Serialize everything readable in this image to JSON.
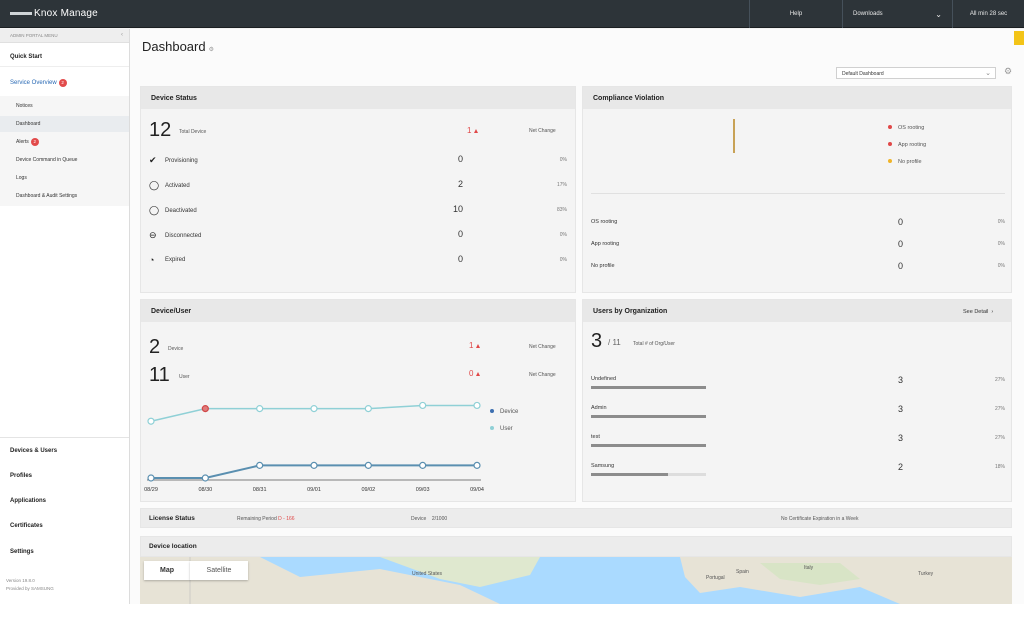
{
  "app": {
    "title": "Knox Manage"
  },
  "topbar": {
    "help": "Help",
    "downloads": "Downloads",
    "timer": "All min 28 sec"
  },
  "sidebar": {
    "header": "ADMIN PORTAL MENU",
    "quick_start": "Quick Start",
    "service_overview": "Service Overview",
    "service_badge": "2",
    "subitems": [
      {
        "label": "Notices"
      },
      {
        "label": "Dashboard"
      },
      {
        "label": "Alerts",
        "badge": "2"
      },
      {
        "label": "Device Command in Queue"
      },
      {
        "label": "Logs"
      },
      {
        "label": "Dashboard & Audit Settings"
      }
    ],
    "lower": [
      "Devices & Users",
      "Profiles",
      "Applications",
      "Certificates",
      "Settings"
    ],
    "version": "Version 19.8.0",
    "provided": "Provided by SAMSUNG"
  },
  "main": {
    "title": "Dashboard",
    "dashboard_select": "Default Dashboard"
  },
  "device_status": {
    "title": "Device Status",
    "total": "12",
    "total_label": "Total Device",
    "change": "1",
    "net_change": "Net Change",
    "rows": [
      {
        "label": "Provisioning",
        "value": "0",
        "pct": "0%",
        "icon": "checkmark-icon"
      },
      {
        "label": "Activated",
        "value": "2",
        "pct": "17%",
        "icon": "activated-icon"
      },
      {
        "label": "Deactivated",
        "value": "10",
        "pct": "83%",
        "icon": "deactivated-icon"
      },
      {
        "label": "Disconnected",
        "value": "0",
        "pct": "0%",
        "icon": "disconnected-icon"
      },
      {
        "label": "Expired",
        "value": "0",
        "pct": "0%",
        "icon": "expired-icon"
      }
    ]
  },
  "compliance": {
    "title": "Compliance Violation",
    "legend": [
      {
        "label": "OS rooting",
        "color": "#e04848"
      },
      {
        "label": "App rooting",
        "color": "#e04848"
      },
      {
        "label": "No profile",
        "color": "#f0b429"
      }
    ],
    "rows": [
      {
        "label": "OS rooting",
        "value": "0",
        "pct": "0%"
      },
      {
        "label": "App rooting",
        "value": "0",
        "pct": "0%"
      },
      {
        "label": "No profile",
        "value": "0",
        "pct": "0%"
      }
    ]
  },
  "device_user": {
    "title": "Device/User",
    "device_count": "2",
    "device_label": "Device",
    "device_change": "1",
    "user_count": "11",
    "user_label": "User",
    "user_change": "0",
    "net_change": "Net Change",
    "legend_device": "Device",
    "legend_user": "User"
  },
  "users_org": {
    "title": "Users by Organization",
    "see_detail": "See Detail",
    "count": "3",
    "total": "11",
    "total_label": "Total # of Org/User",
    "rows": [
      {
        "label": "Undefined",
        "value": "3",
        "pct": "27%",
        "fill": 0.27
      },
      {
        "label": "Admin",
        "value": "3",
        "pct": "27%",
        "fill": 0.27
      },
      {
        "label": "test",
        "value": "3",
        "pct": "27%",
        "fill": 0.27
      },
      {
        "label": "Samsung",
        "value": "2",
        "pct": "18%",
        "fill": 0.18
      }
    ]
  },
  "license": {
    "title": "License Status",
    "remaining_label": "Remaining Period",
    "remaining": "D - 166",
    "device_label": "Device",
    "device": "2/1000",
    "note": "No Certificate Expiration in a Week"
  },
  "location": {
    "title": "Device location",
    "map_btn": "Map",
    "satellite_btn": "Satellite",
    "labels": [
      "United States",
      "Portugal",
      "Spain",
      "Italy",
      "Turkey"
    ]
  },
  "chart_data": {
    "type": "line",
    "x": [
      "08/29",
      "08/30",
      "08/31",
      "09/01",
      "09/02",
      "09/03",
      "09/04"
    ],
    "series": [
      {
        "name": "Device",
        "values": [
          0,
          0,
          2,
          2,
          2,
          2,
          2
        ],
        "color": "#5a8fb0"
      },
      {
        "name": "User",
        "values": [
          9,
          11,
          11,
          11,
          11,
          11.5,
          11.5
        ],
        "color": "#8fd0d6"
      }
    ],
    "ylim": [
      0,
      13
    ]
  }
}
